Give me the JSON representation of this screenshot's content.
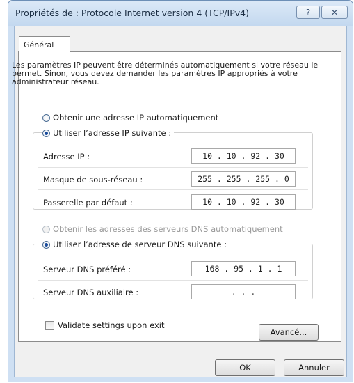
{
  "window": {
    "title": "Propriétés de : Protocole Internet version 4 (TCP/IPv4)",
    "help_icon": "question-icon",
    "close_icon": "close-icon"
  },
  "tab": {
    "label": "Général"
  },
  "description": "Les paramètres IP peuvent être déterminés automatiquement si votre réseau le permet. Sinon, vous devez demander les paramètres IP appropriés à votre administrateur réseau.",
  "ip": {
    "auto_option": "Obtenir une adresse IP automatiquement",
    "manual_option": "Utiliser l’adresse IP suivante :",
    "address_label": "Adresse IP :",
    "address_value": "10 . 10 . 92 . 30",
    "mask_label": "Masque de sous-réseau :",
    "mask_value": "255 . 255 . 255 . 0",
    "gateway_label": "Passerelle par défaut :",
    "gateway_value": "10 . 10 . 92 . 30",
    "selected": "manual"
  },
  "dns": {
    "auto_option": "Obtenir les adresses des serveurs DNS automatiquement",
    "manual_option": "Utiliser l’adresse de serveur DNS suivante :",
    "preferred_label": "Serveur DNS préféré :",
    "preferred_value": "168 . 95 . 1 . 1",
    "alternate_label": "Serveur DNS auxiliaire :",
    "alternate_value": ". . .",
    "selected": "manual"
  },
  "validate": {
    "label": "Validate settings upon exit",
    "checked": false
  },
  "buttons": {
    "advanced": "Avancé...",
    "ok": "OK",
    "cancel": "Annuler"
  }
}
